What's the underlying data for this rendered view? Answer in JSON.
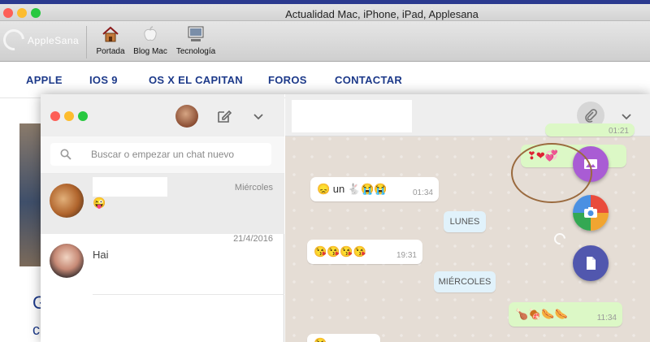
{
  "window": {
    "title": "Actualidad Mac, iPhone, iPad, Applesana",
    "logo_text": "AppleSana"
  },
  "toolbar": {
    "items": [
      {
        "label": "Portada",
        "icon": "home-icon"
      },
      {
        "label": "Blog Mac",
        "icon": "apple-icon"
      },
      {
        "label": "Tecnología",
        "icon": "computer-icon"
      }
    ]
  },
  "site_nav": [
    "APPLE",
    "IOS 9",
    "OS X EL CAPITAN",
    "FOROS",
    "CONTACTAR"
  ],
  "article": {
    "heading_fragment": "G",
    "subheading_fragment": "c"
  },
  "whatsapp": {
    "search": {
      "placeholder": "Buscar o empezar un chat nuevo"
    },
    "chats": [
      {
        "time": "Miércoles",
        "preview": "😜"
      },
      {
        "time": "21/4/2016",
        "preview": "Hai"
      }
    ],
    "messages": {
      "top_out_time": "01:21",
      "hearts": "❣❤💞",
      "msg1_text": "😞 un 🐇😭😭",
      "msg1_time": "01:34",
      "date_lunes": "LUNES",
      "msg2_text": "😘😘😘😘",
      "msg2_time": "19:31",
      "date_miercoles": "MIÉRCOLES",
      "msg3_text": "🍗🍖🌭🌭",
      "msg3_time": "11:34",
      "msg4_text": "😘"
    },
    "fabs": [
      {
        "icon": "image-icon",
        "color": "#a95cd4"
      },
      {
        "icon": "camera-icon",
        "color": "#f1a531"
      },
      {
        "icon": "document-icon",
        "color": "#5157ae"
      }
    ]
  },
  "colors": {
    "nav_blue": "#1d3a8a",
    "bubble_out": "#dcf8c6",
    "chat_bg": "#e5ddd5",
    "annotation": "#9a6a3e"
  }
}
